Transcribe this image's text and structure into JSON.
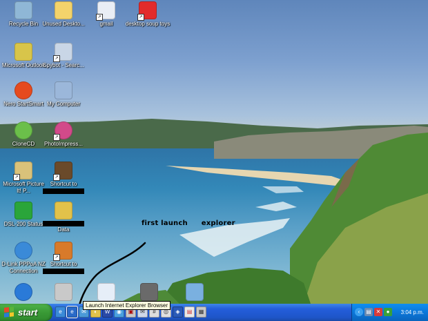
{
  "desktop_icons": [
    {
      "id": "recycle",
      "label": "Recycle Bin",
      "icon": "recycle-bin-icon",
      "color": "#8fb7d6"
    },
    {
      "id": "unused",
      "label": "Unused Deskto...",
      "icon": "folder-icon",
      "color": "#f3d36b"
    },
    {
      "id": "gmail",
      "label": "gmail",
      "icon": "gmail-icon",
      "color": "#e9eef5"
    },
    {
      "id": "soup",
      "label": "desktop soup toys",
      "icon": "soup-s-icon",
      "color": "#e22b2b"
    },
    {
      "id": "outlook",
      "label": "Microsoft Outlook",
      "icon": "outlook-icon",
      "color": "#d8c54a"
    },
    {
      "id": "spybot",
      "label": "Spybot - Searc...",
      "icon": "spybot-icon",
      "color": "#c9d6e6"
    },
    {
      "id": "nero",
      "label": "Nero StartSmart",
      "icon": "nero-icon",
      "color": "#e64a1e"
    },
    {
      "id": "mycomputer",
      "label": "My Computer",
      "icon": "my-computer-icon",
      "color": "#9bb7da"
    },
    {
      "id": "clonecd",
      "label": "CloneCD",
      "icon": "clonecd-icon",
      "color": "#6bbf4a"
    },
    {
      "id": "photoimpress",
      "label": "PhotoImpress...",
      "icon": "photoimpression-icon",
      "color": "#d24a8a"
    },
    {
      "id": "pictureit",
      "label": "Microsoft Picture It! P...",
      "icon": "picture-it-icon",
      "color": "#d9c27a"
    },
    {
      "id": "shortcut1",
      "label": "Shortcut to",
      "icon": "shortcut-user-icon",
      "color": "#6a4a2a"
    },
    {
      "id": "dsl",
      "label": "DSL-200 Status",
      "icon": "dsl-status-icon",
      "color": "#2aa53a"
    },
    {
      "id": "data",
      "label": "Data",
      "icon": "locked-folder-icon",
      "color": "#e2c24a"
    },
    {
      "id": "dlink",
      "label": "D-Link PPPoA NZ Connection",
      "icon": "dlink-connection-icon",
      "color": "#3a8ad8"
    },
    {
      "id": "shortcut2",
      "label": "Shortcut to",
      "icon": "shortcut-user-icon",
      "color": "#d87a2a"
    }
  ],
  "annotation": {
    "first": "first launch",
    "second": "explorer"
  },
  "tooltip": "Launch Internet Explorer Browser",
  "taskbar": {
    "start_label": "start",
    "clock": "3:04 p.m."
  },
  "quicklaunch": [
    "ie-icon",
    "ie-icon",
    "outlook-express-icon",
    "media-icon",
    "word-icon",
    "browser-icon",
    "pdf-icon",
    "mail-icon",
    "calc-icon",
    "app-icon",
    "app-icon",
    "app-icon",
    "app-icon"
  ]
}
